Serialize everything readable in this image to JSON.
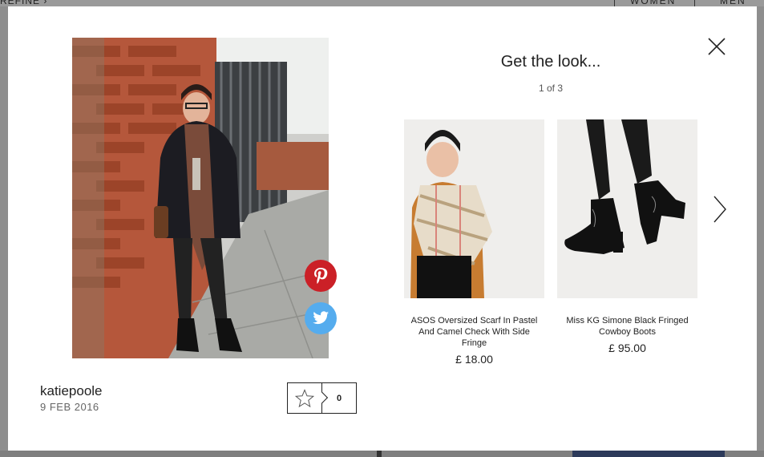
{
  "background": {
    "refine_label": "REFINE",
    "nav_women": "WOMEN",
    "nav_men": "MEN"
  },
  "modal": {
    "close_icon": "close-icon",
    "look": {
      "username": "katiepoole",
      "date": "9 FEB 2016",
      "like_count": "0",
      "share_pinterest_icon": "pinterest-icon",
      "share_twitter_icon": "twitter-icon"
    },
    "get_the_look": {
      "title": "Get the look...",
      "counter": "1 of 3",
      "products": [
        {
          "name": "ASOS Oversized Scarf In Pastel And Camel Check With Side Fringe",
          "price": "£ 18.00"
        },
        {
          "name": "Miss KG Simone Black Fringed Cowboy Boots",
          "price": "£ 95.00"
        }
      ],
      "next_icon": "chevron-right-icon"
    }
  },
  "colors": {
    "pinterest": "#cb2027",
    "twitter": "#55acee"
  }
}
